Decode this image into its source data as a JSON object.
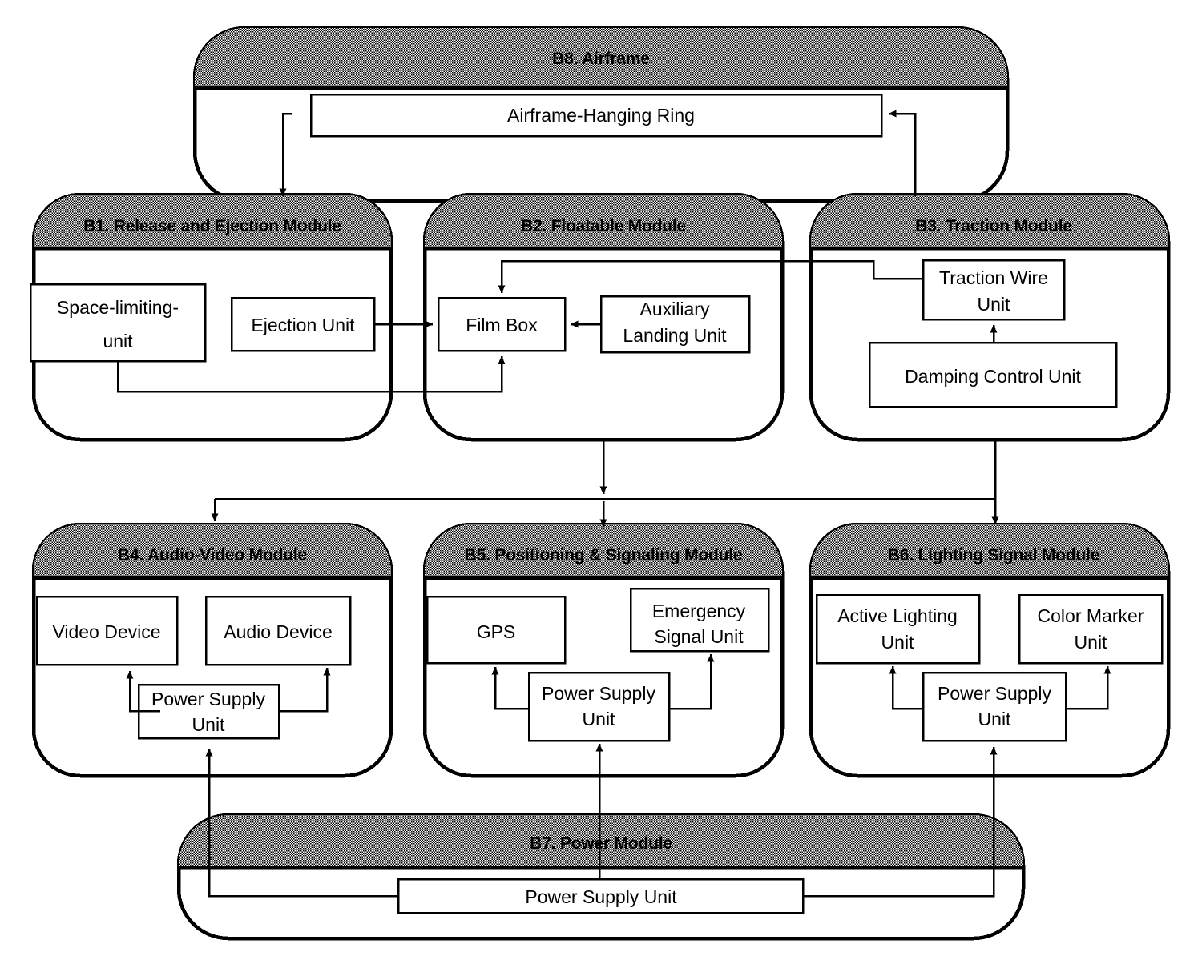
{
  "diagram": {
    "title_hidden": "",
    "modules": [
      {
        "id": "B8",
        "label": "B8. Airframe",
        "units": [
          {
            "id": "ring",
            "label": "Airframe-Hanging Ring"
          }
        ]
      },
      {
        "id": "B1",
        "label": "B1. Release and Ejection Module",
        "units": [
          {
            "id": "space",
            "label": "Space-limiting-unit",
            "line1": "Space-limiting-",
            "line2": "unit"
          },
          {
            "id": "eject",
            "label": "Ejection Unit",
            "line1": "Ejection Unit",
            "line2": ""
          }
        ]
      },
      {
        "id": "B2",
        "label": "B2. Floatable Module",
        "units": [
          {
            "id": "film",
            "label": "Film Box",
            "line1": "Film Box",
            "line2": ""
          },
          {
            "id": "aux",
            "label": "Auxiliary Landing Unit",
            "line1": "Auxiliary",
            "line2": "Landing Unit"
          }
        ]
      },
      {
        "id": "B3",
        "label": "B3. Traction Module",
        "units": [
          {
            "id": "wire",
            "label": "Traction Wire Unit",
            "line1": "Traction Wire",
            "line2": "Unit"
          },
          {
            "id": "damp",
            "label": "Damping Control Unit",
            "line1": "Damping Control Unit",
            "line2": ""
          }
        ]
      },
      {
        "id": "B4",
        "label": "B4. Audio-Video Module",
        "units": [
          {
            "id": "video",
            "label": "Video Device",
            "line1": "Video Device",
            "line2": ""
          },
          {
            "id": "audio",
            "label": "Audio Device",
            "line1": "Audio Device",
            "line2": ""
          },
          {
            "id": "psu4",
            "label": "Power Supply Unit",
            "line1": "Power Supply",
            "line2": "Unit"
          }
        ]
      },
      {
        "id": "B5",
        "label": "B5. Positioning & Signaling Module",
        "units": [
          {
            "id": "gps",
            "label": "GPS",
            "line1": "GPS",
            "line2": ""
          },
          {
            "id": "emerg",
            "label": "Emergency Signal Unit",
            "line1": "Emergency",
            "line2": "Signal Unit"
          },
          {
            "id": "psu5",
            "label": "Power Supply Unit",
            "line1": "Power Supply",
            "line2": "Unit"
          }
        ]
      },
      {
        "id": "B6",
        "label": "B6. Lighting Signal Module",
        "units": [
          {
            "id": "active",
            "label": "Active Lighting Unit",
            "line1": "Active  Lighting",
            "line2": "Unit"
          },
          {
            "id": "color",
            "label": "Color Marker Unit",
            "line1": "Color Marker",
            "line2": "Unit"
          },
          {
            "id": "psu6",
            "label": "Power Supply Unit",
            "line1": "Power Supply",
            "line2": "Unit"
          }
        ]
      },
      {
        "id": "B7",
        "label": "B7. Power  Module",
        "units": [
          {
            "id": "psu7",
            "label": "Power Supply Unit",
            "line1": "Power Supply Unit",
            "line2": ""
          }
        ]
      }
    ],
    "colors": {
      "stroke": "#000000",
      "background": "#ffffff",
      "header_fill": "#cccccc",
      "unit_fill": "#ffffff"
    }
  }
}
